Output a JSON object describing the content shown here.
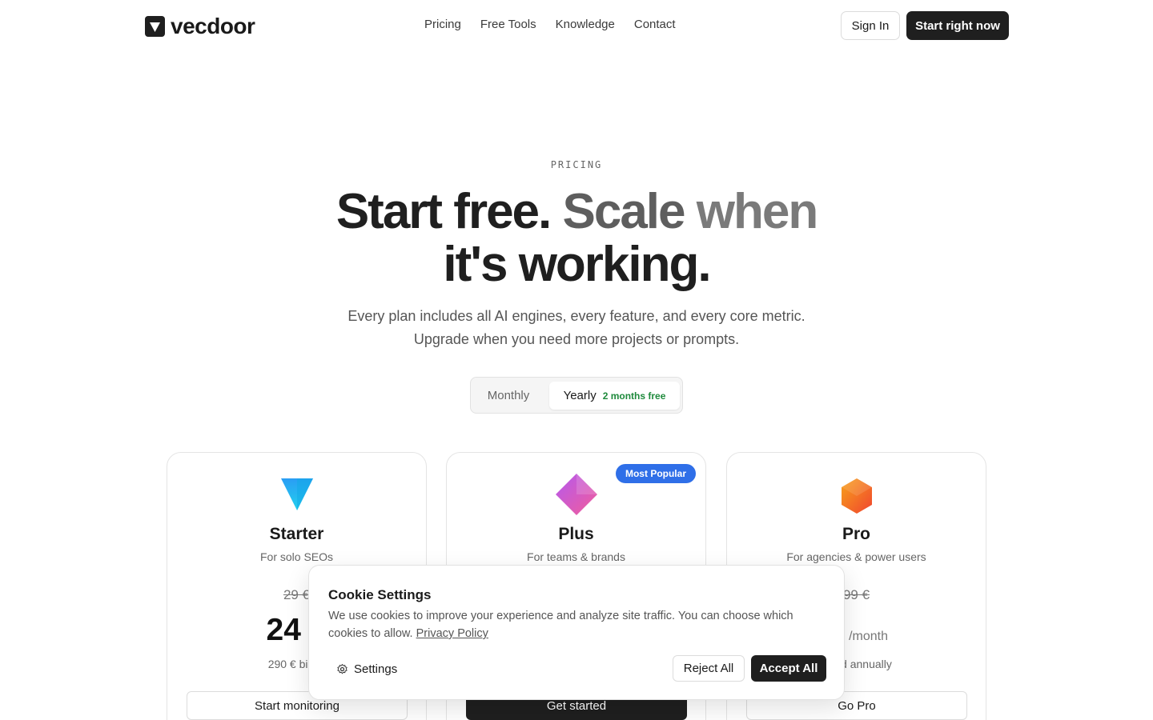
{
  "header": {
    "logo_text": "vecdoor",
    "nav": [
      "Pricing",
      "Free Tools",
      "Knowledge",
      "Contact"
    ],
    "sign_in": "Sign In",
    "start": "Start right now"
  },
  "hero": {
    "eyebrow": "PRICING",
    "headline_part1": "Start free. ",
    "headline_part2": "Scale ",
    "headline_part3": "when",
    "headline_line2": "it's working.",
    "subhead_line1": "Every plan includes all AI engines, every feature, and every core metric.",
    "subhead_line2": "Upgrade when you need more projects or prompts."
  },
  "billing_toggle": {
    "monthly": "Monthly",
    "yearly": "Yearly",
    "yearly_badge": "2 months free",
    "selected": "Yearly"
  },
  "plans": [
    {
      "name": "Starter",
      "desc": "For solo SEOs",
      "old_price": "29 €",
      "price": "24 €",
      "billed": "290 € billed",
      "cta": "Start monitoring"
    },
    {
      "name": "Plus",
      "desc": "For teams & brands",
      "badge": "Most Popular",
      "cta": "Get started"
    },
    {
      "name": "Pro",
      "desc": "For agencies & power users",
      "old_price": "99 €",
      "price": "€",
      "period": "/month",
      "billed": "billed annually",
      "cta": "Go Pro"
    }
  ],
  "cookie": {
    "title": "Cookie Settings",
    "text": "We use cookies to improve your experience and analyze site traffic. You can choose which cookies to allow.",
    "link": "Privacy Policy",
    "settings": "Settings",
    "reject": "Reject All",
    "accept": "Accept All"
  },
  "colors": {
    "accent_dark": "#1f1f1f",
    "badge_blue": "#2f6fe8",
    "badge_green": "#1e8a3c"
  }
}
